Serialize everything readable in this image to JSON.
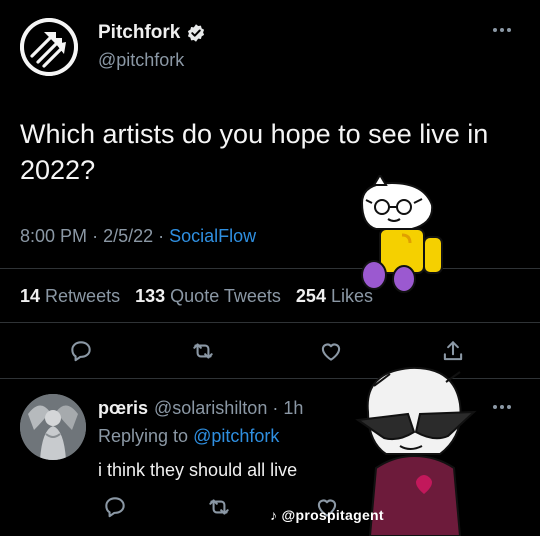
{
  "tweet": {
    "author": {
      "name": "Pitchfork",
      "handle": "@pitchfork",
      "verified": true
    },
    "text": "Which artists do you hope to see live in 2022?",
    "time": "8:00 PM",
    "date": "2/5/22",
    "source": "SocialFlow",
    "separator": "·",
    "stats": {
      "retweets_count": "14",
      "retweets_label": "Retweets",
      "quotes_count": "133",
      "quotes_label": "Quote Tweets",
      "likes_count": "254",
      "likes_label": "Likes"
    }
  },
  "reply": {
    "name": "pœris",
    "handle": "@solarishilton",
    "age": "1h",
    "separator": "·",
    "replying_prefix": "Replying to",
    "replying_to": "@pitchfork",
    "text": "i think they should all live"
  },
  "watermark": {
    "text": "@prospitagent"
  },
  "icons": {
    "more": "more-horizontal-icon",
    "reply": "reply-bubble-icon",
    "retweet": "retweet-icon",
    "like": "heart-icon",
    "share": "share-icon",
    "verified": "verified-badge-icon"
  },
  "colors": {
    "background": "#000000",
    "text": "#e7e9ea",
    "muted": "#8b98a5",
    "link": "#2f8fe0",
    "divider": "#2f3336",
    "reply_sticker_heart": "#c2185b",
    "sticker_yellow": "#f5d000",
    "sticker_purple": "#9b59d0",
    "sticker_shirt": "#6d1b3b"
  }
}
